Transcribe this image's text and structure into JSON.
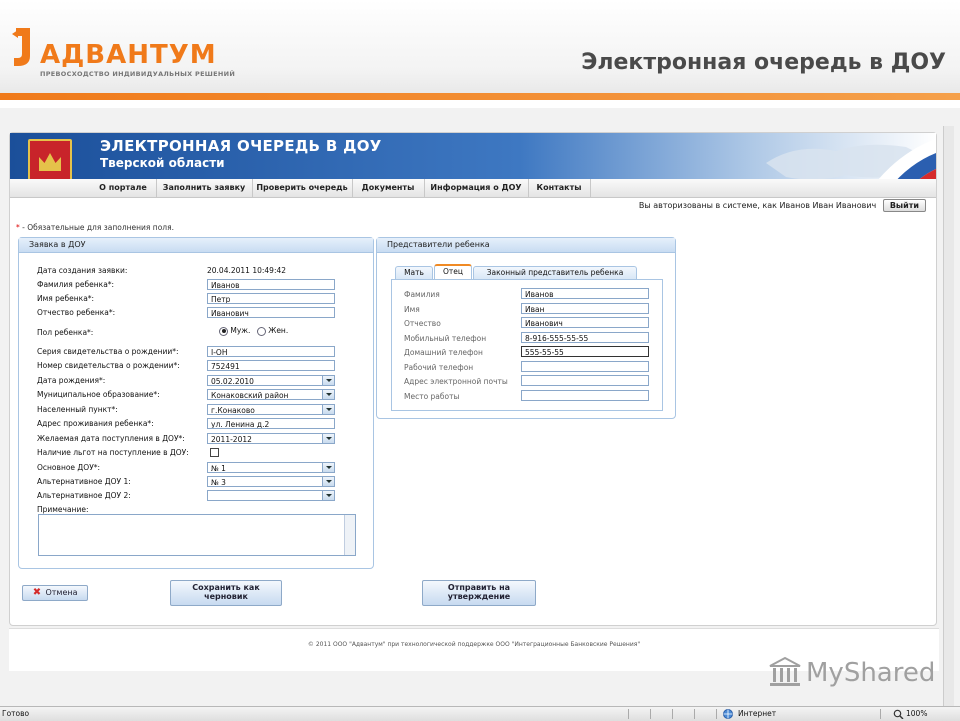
{
  "slide": {
    "logo_name": "АДВАНТУМ",
    "logo_tagline": "ПРЕВОСХОДСТВО ИНДИВИДУАЛЬНЫХ РЕШЕНИЙ",
    "title": "Электронная очередь в ДОУ",
    "accent_color": "#f07a1a"
  },
  "site": {
    "banner_title": "ЭЛЕКТРОННАЯ ОЧЕРЕДЬ В ДОУ",
    "banner_subtitle": "Тверской области",
    "menu": [
      "О портале",
      "Заполнить заявку",
      "Проверить очередь",
      "Документы",
      "Информация о ДОУ",
      "Контакты"
    ],
    "auth_text": "Вы авторизованы в системе, как Иванов Иван Иванович",
    "logout_label": "Выйти",
    "required_note_star": "*",
    "required_note": " - Обязательные для заполнения поля."
  },
  "application": {
    "panel_title": "Заявка в ДОУ",
    "created_label": "Дата создания заявки:",
    "created_value": "20.04.2011 10:49:42",
    "surname_label": "Фамилия ребенка*:",
    "surname_value": "Иванов",
    "name_label": "Имя ребенка*:",
    "name_value": "Петр",
    "patronymic_label": "Отчество ребенка*:",
    "patronymic_value": "Иванович",
    "sex_label": "Пол ребенка*:",
    "sex_male": "Муж.",
    "sex_female": "Жен.",
    "cert_series_label": "Серия свидетельства о рождении*:",
    "cert_series_value": "I-ОН",
    "cert_number_label": "Номер свидетельства о рождении*:",
    "cert_number_value": "752491",
    "birth_label": "Дата рождения*:",
    "birth_value": "05.02.2010",
    "municipality_label": "Муниципальное образование*:",
    "municipality_value": "Конаковский район",
    "locality_label": "Населенный пункт*:",
    "locality_value": "г.Конаково",
    "address_label": "Адрес проживания ребенка*:",
    "address_value": "ул. Ленина д.2",
    "desired_date_label": "Желаемая дата поступления в ДОУ*:",
    "desired_date_value": "2011-2012",
    "benefits_label": "Наличие льгот на поступление в ДОУ:",
    "main_dou_label": "Основное ДОУ*:",
    "main_dou_value": "№ 1",
    "alt1_label": "Альтернативное ДОУ 1:",
    "alt1_value": "№ 3",
    "alt2_label": "Альтернативное ДОУ 2:",
    "alt2_value": "",
    "note_label": "Примечание:"
  },
  "representatives": {
    "panel_title": "Представители ребенка",
    "tabs": [
      "Мать",
      "Отец",
      "Законный представитель ребенка"
    ],
    "active_tab": "Отец",
    "fields": [
      {
        "label": "Фамилия",
        "value": "Иванов"
      },
      {
        "label": "Имя",
        "value": "Иван"
      },
      {
        "label": "Отчество",
        "value": "Иванович"
      },
      {
        "label": "Мобильный телефон",
        "value": "8-916-555-55-55"
      },
      {
        "label": "Домашний телефон",
        "value": "555-55-55"
      },
      {
        "label": "Рабочий телефон",
        "value": ""
      },
      {
        "label": "Адрес электронной почты",
        "value": ""
      },
      {
        "label": "Место работы",
        "value": ""
      }
    ]
  },
  "actions": {
    "cancel": "Отмена",
    "save_line1": "Сохранить как",
    "save_line2": "черновик",
    "send_line1": "Отправить на",
    "send_line2": "утверждение"
  },
  "footer": {
    "copyright": "© 2011 ООО \"Адвантум\" при технологической поддержке ООО \"Интеграционные Банковские Решения\""
  },
  "watermark": "MyShared",
  "statusbar": {
    "status": "Готово",
    "zone": "Интернет",
    "zoom": "100%"
  }
}
